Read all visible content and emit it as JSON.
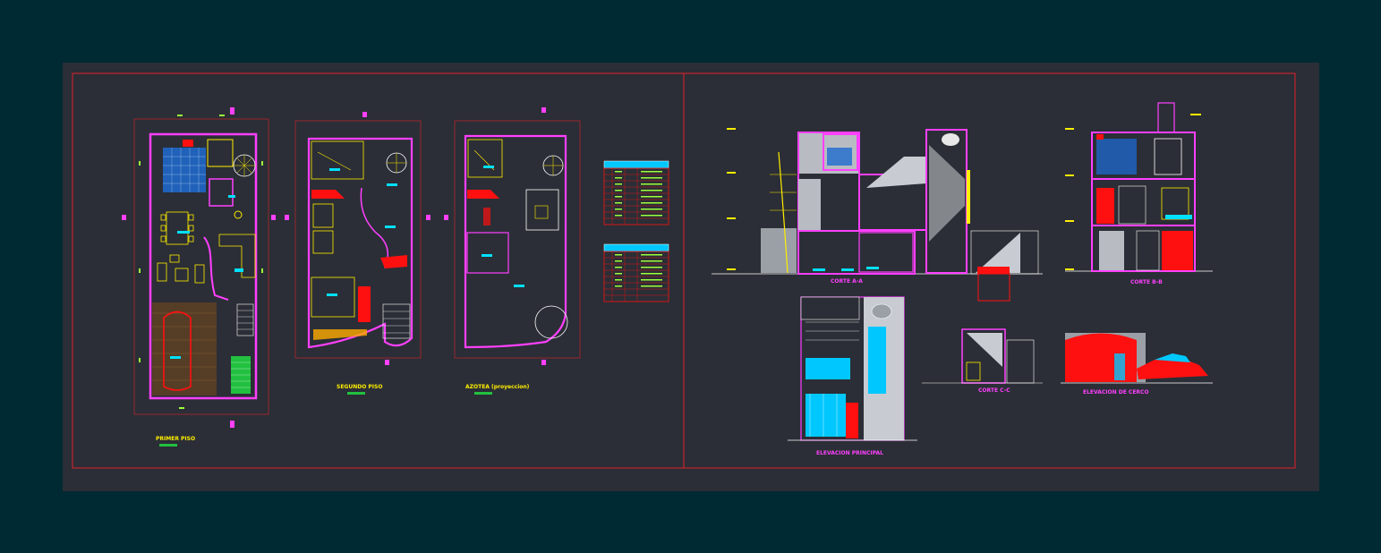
{
  "viewport": {
    "background": "#002a33",
    "sheet_background": "#2b2e36"
  },
  "colors": {
    "border": "#e0202a",
    "wall": "#ff40ff",
    "dimension": "#9dff3a",
    "text_yellow": "#ffee00",
    "cyan": "#00e0ff",
    "red": "#ff1010",
    "white": "#ffffff",
    "table_header": "#00c8ff"
  },
  "plans": {
    "ground_floor": {
      "title": "PRIMER PISO"
    },
    "second_floor": {
      "title": "SEGUNDO PISO"
    },
    "roof": {
      "title": "AZOTEA (proyeccion)"
    }
  },
  "sections": {
    "section_a": {
      "title": "CORTE A-A"
    },
    "section_b": {
      "title": "CORTE B-B"
    },
    "section_c": {
      "title": "CORTE C-C"
    },
    "front_elevation": {
      "title": "ELEVACION PRINCIPAL"
    },
    "fence_elevation": {
      "title": "ELEVACION DE CERCO"
    }
  },
  "tables": {
    "doors": {
      "rows": 9,
      "cols": 4
    },
    "windows": {
      "rows": 9,
      "cols": 4
    }
  }
}
